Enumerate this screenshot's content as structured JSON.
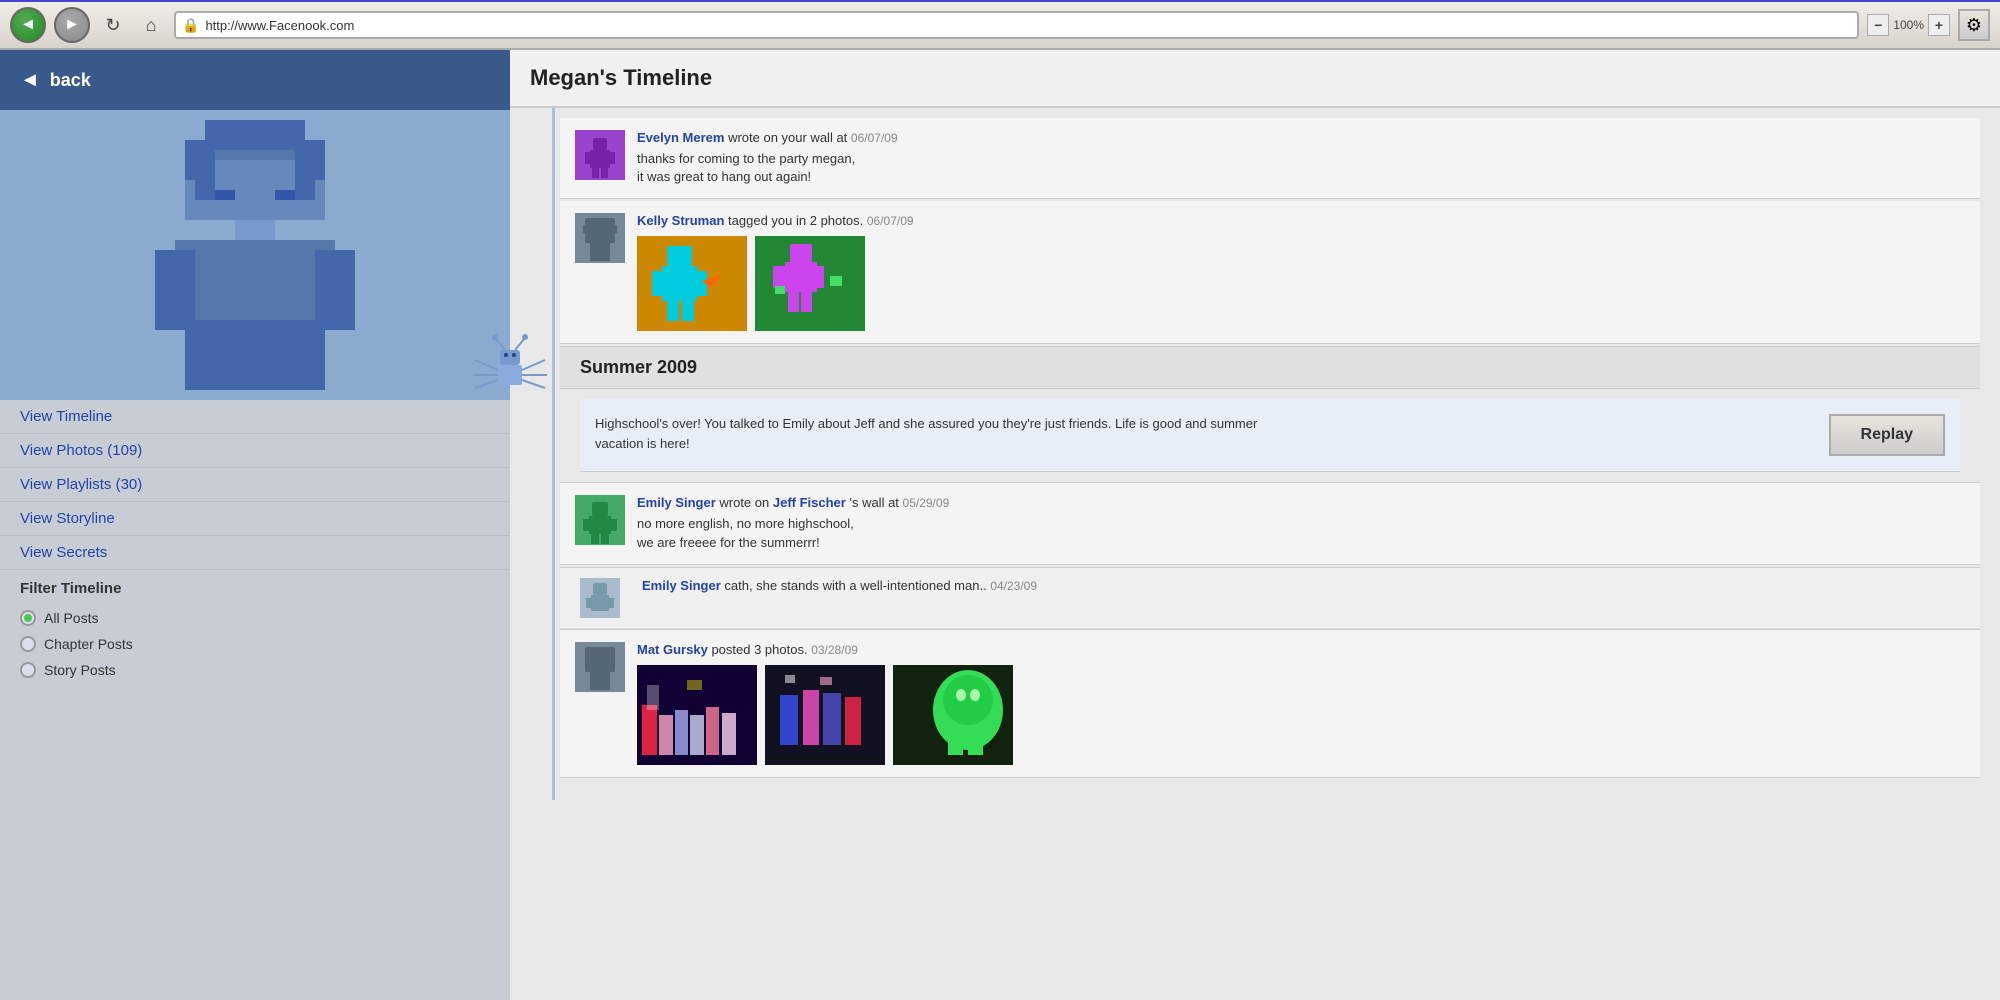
{
  "browser": {
    "url": "http://www.Facenook.com",
    "zoom": "100%",
    "zoom_minus": "−",
    "zoom_plus": "+",
    "back_arrow": "◄",
    "fwd_arrow": "►"
  },
  "sidebar": {
    "back_label": "back",
    "nav_items": [
      {
        "id": "view-timeline",
        "label": "View Timeline"
      },
      {
        "id": "view-photos",
        "label": "View Photos (109)"
      },
      {
        "id": "view-playlists",
        "label": "View Playlists (30)"
      },
      {
        "id": "view-storyline",
        "label": "View Storyline"
      },
      {
        "id": "view-secrets",
        "label": "View Secrets"
      }
    ],
    "filter_title": "Filter Timeline",
    "filter_items": [
      {
        "id": "all-posts",
        "label": "All Posts",
        "selected": true
      },
      {
        "id": "chapter-posts",
        "label": "Chapter Posts",
        "selected": false
      },
      {
        "id": "story-posts",
        "label": "Story Posts",
        "selected": false
      }
    ]
  },
  "main": {
    "timeline_title": "Megan's Timeline",
    "season_header": "Summer 2009",
    "story_text": "Highschool's over! You talked to Emily about Jeff and she assured you they're just friends. Life is good and summer vacation is here!",
    "replay_label": "Replay",
    "feed_items": [
      {
        "id": "evelyn-wall",
        "author": "Evelyn Merem",
        "action": "wrote on your wall at",
        "date": "06/07/09",
        "message": "thanks for coming to the party megan,\nit was great to hang out again!"
      },
      {
        "id": "kelly-tagged",
        "author": "Kelly Struman",
        "action": "tagged you in 2 photos.",
        "date": "06/07/09"
      },
      {
        "id": "emily-wall",
        "author": "Emily Singer",
        "action": "wrote on",
        "target": "Jeff Fischer",
        "action2": "'s wall at",
        "date": "05/29/09",
        "message": "no more english, no more highschool,\nwe are freeee for the summerrr!"
      },
      {
        "id": "emily-cath",
        "author": "Emily Singer",
        "action": "cath, she stands with a well-intentioned man..",
        "date": "04/23/09"
      },
      {
        "id": "mat-photos",
        "author": "Mat Gursky",
        "action": "posted 3 photos.",
        "date": "03/28/09"
      }
    ]
  }
}
